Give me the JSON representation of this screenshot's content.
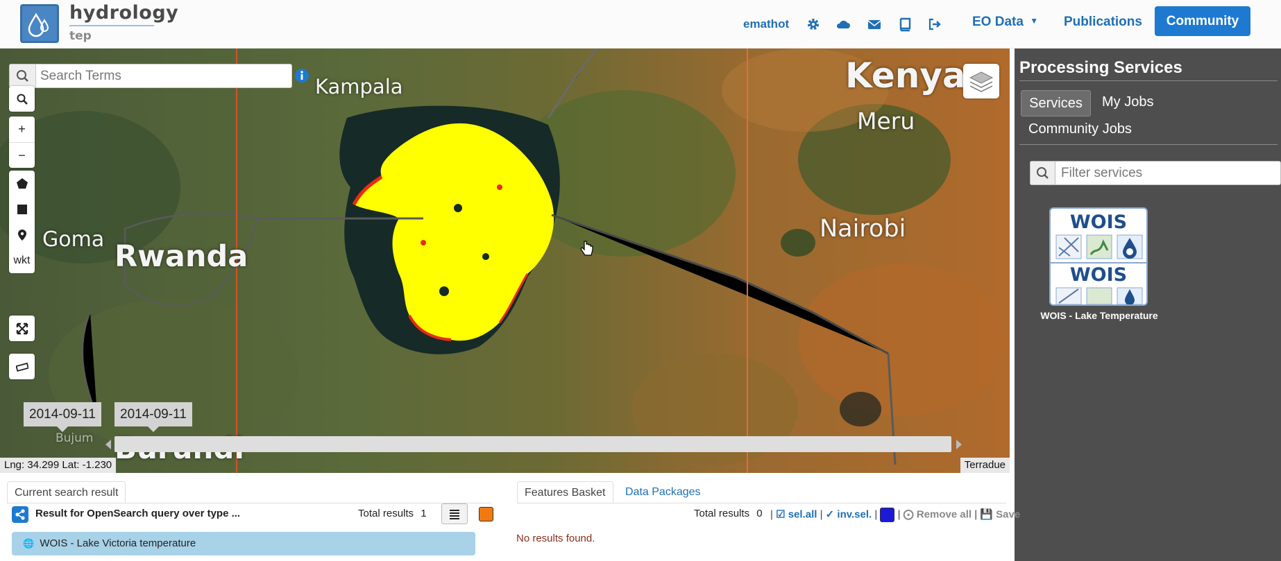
{
  "header": {
    "logo_title": "hydrology",
    "logo_subtitle": "tep",
    "username": "emathot",
    "icons": [
      "gear-icon",
      "cloud-icon",
      "envelope-icon",
      "book-icon",
      "logout-icon"
    ],
    "nav": {
      "eo_data": "EO Data",
      "publications": "Publications",
      "community": "Community"
    }
  },
  "map": {
    "search_placeholder": "Search Terms",
    "labels": {
      "kampala": "Kampala",
      "kenya": "Kenya",
      "meru": "Meru",
      "nairobi": "Nairobi",
      "goma": "Goma",
      "rwanda": "Rwanda",
      "burundi": "Burundi",
      "bujumbura": "Bujum"
    },
    "tools": {
      "wkt": "wkt"
    },
    "time": {
      "start_date": "2014-09-11",
      "end_date": "2014-09-11"
    },
    "coordinates": "Lng: 34.299 Lat: -1.230",
    "attribution": "Terradue"
  },
  "panel": {
    "title": "Processing Services",
    "tabs": {
      "services": "Services",
      "my_jobs": "My Jobs",
      "community_jobs": "Community Jobs"
    },
    "filter_placeholder": "Filter services",
    "service": {
      "logo_word": "WOIS",
      "name": "WOIS - Lake Temperature"
    }
  },
  "results": {
    "tab_current": "Current search result",
    "query_text": "Result for OpenSearch query over type ...",
    "total_label": "Total results",
    "total_value": "1",
    "items": [
      "WOIS - Lake Victoria temperature"
    ],
    "color": "#f07a12"
  },
  "basket": {
    "tab_features": "Features Basket",
    "tab_packages": "Data Packages",
    "total_label": "Total results",
    "total_value": "0",
    "actions": {
      "sel_all": "sel.all",
      "inv_sel": "inv.sel.",
      "remove_all": "Remove all",
      "save": "Save"
    },
    "empty_message": "No results found.",
    "color": "#1a1ad8"
  },
  "colors": {
    "brand_blue": "#1d7ad0",
    "panel_bg": "#4e4e4e",
    "lake_overlay": "#ffff00",
    "lake_edge": "#e82b14"
  }
}
